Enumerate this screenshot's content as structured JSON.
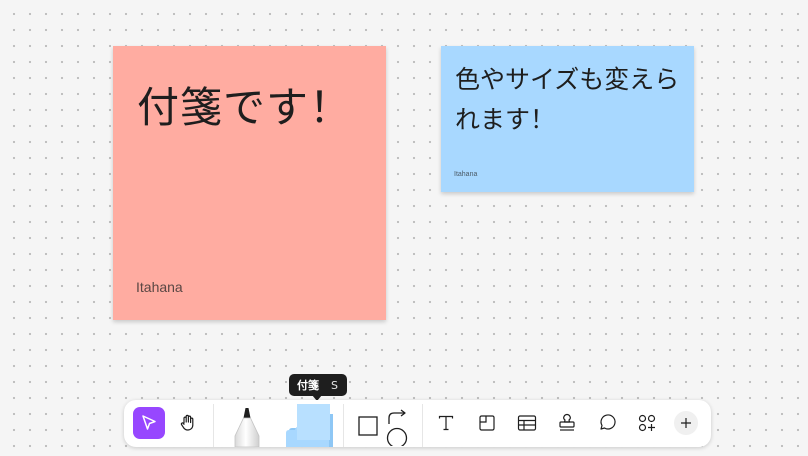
{
  "canvas": {
    "background": "#f5f5f5",
    "dot_color": "#bdbdbd"
  },
  "stickies": [
    {
      "text": "付箋です！",
      "author": "Itahana",
      "color": "#ffaca1"
    },
    {
      "text": "色やサイズも変えられます！",
      "author": "Itahana",
      "color": "#a8d8ff"
    }
  ],
  "tooltip": {
    "label": "付箋",
    "shortcut": "S"
  },
  "toolbar": {
    "accent": "#9747ff",
    "tools": [
      {
        "name": "move",
        "icon": "cursor-arrow-icon",
        "active": true
      },
      {
        "name": "hand",
        "icon": "hand-icon",
        "active": false
      },
      {
        "name": "marker",
        "icon": "marker-pen-icon",
        "active": false
      },
      {
        "name": "sticky",
        "icon": "sticky-note-stack-icon",
        "active": false
      },
      {
        "name": "shape",
        "icon": "shapes-icon",
        "active": false
      },
      {
        "name": "text",
        "icon": "text-icon",
        "active": false
      },
      {
        "name": "section",
        "icon": "section-icon",
        "active": false
      },
      {
        "name": "table",
        "icon": "table-icon",
        "active": false
      },
      {
        "name": "stamp",
        "icon": "stamp-icon",
        "active": false
      },
      {
        "name": "comment",
        "icon": "comment-bubble-icon",
        "active": false
      },
      {
        "name": "widgets",
        "icon": "widgets-plus-icon",
        "active": false
      },
      {
        "name": "more",
        "icon": "plus-icon",
        "active": false
      }
    ]
  }
}
